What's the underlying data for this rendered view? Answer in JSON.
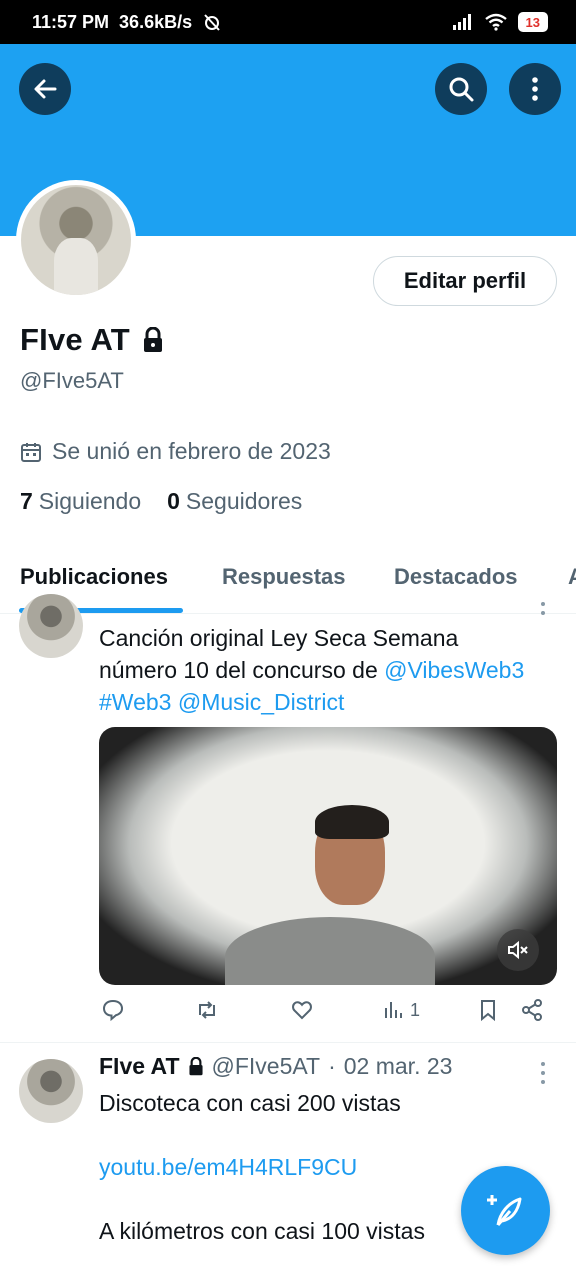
{
  "status_bar": {
    "time": "11:57 PM",
    "speed": "36.6kB/s",
    "battery": "13"
  },
  "profile": {
    "display_name": "FIve AT",
    "handle": "@FIve5AT",
    "edit_button": "Editar perfil",
    "joined": "Se unió en febrero de 2023",
    "following_count": "7",
    "following_label": "Siguiendo",
    "followers_count": "0",
    "followers_label": "Seguidores",
    "banner_color": "#1DA1F2"
  },
  "tabs": [
    {
      "label": "Publicaciones"
    },
    {
      "label": "Respuestas"
    },
    {
      "label": "Destacados"
    },
    {
      "label": "A"
    }
  ],
  "tweet1": {
    "text_line1": "Canción original Ley Seca Semana",
    "text_line2_prefix": "número 10 del concurso de ",
    "mention1": "@VibesWeb3",
    "hashtag": "#Web3",
    "mention2": "@Music_District",
    "views": "1"
  },
  "tweet2": {
    "name": "FIve AT",
    "handle": "@FIve5AT",
    "separator": "·",
    "date": "02 mar. 23",
    "line1": "Discoteca con casi 200 vistas",
    "link": "youtu.be/em4H4RLF9CU",
    "line3": "A kilómetros con casi 100 vistas"
  },
  "accent_color": "#1D9BF0",
  "icons": [
    "back-arrow-icon",
    "search-icon",
    "more-vertical-icon",
    "lock-icon",
    "calendar-icon",
    "reply-icon",
    "retweet-icon",
    "like-icon",
    "views-icon",
    "bookmark-icon",
    "share-icon",
    "mute-icon",
    "compose-icon"
  ]
}
